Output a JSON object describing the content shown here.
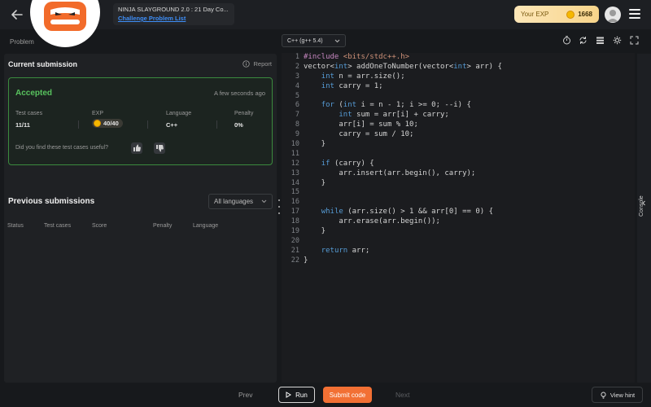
{
  "header": {
    "title": "NINJA SLAYGROUND 2.0 : 21 Day Co...",
    "link": "Challenge Problem List",
    "exp_label": "Your EXP",
    "exp_value": "1668"
  },
  "tabs": [
    {
      "label": "Problem"
    }
  ],
  "current_submission": {
    "title": "Current submission",
    "report_label": "Report",
    "status": "Accepted",
    "time": "A few seconds ago",
    "stats": {
      "test_cases_label": "Test cases",
      "test_cases_value": "11/11",
      "exp_label": "EXP",
      "exp_value": "40/40",
      "language_label": "Language",
      "language_value": "C++",
      "penalty_label": "Penalty",
      "penalty_value": "0%"
    },
    "feedback_question": "Did you find these test cases useful?"
  },
  "previous_submissions": {
    "title": "Previous submissions",
    "filter_value": "All languages",
    "columns": [
      "Status",
      "Test cases",
      "Score",
      "Penalty",
      "Language"
    ]
  },
  "editor": {
    "language": "C++ (g++ 5.4)",
    "line_numbers": [
      "1",
      "2",
      "3",
      "4",
      "5",
      "6",
      "7",
      "8",
      "9",
      "10",
      "11",
      "12",
      "13",
      "14",
      "15",
      "16",
      "17",
      "18",
      "19",
      "20",
      "21",
      "22"
    ]
  },
  "console_label": "Console",
  "footer": {
    "prev": "Prev",
    "run": "Run",
    "submit": "Submit code",
    "next": "Next",
    "hint": "View hint"
  },
  "colors": {
    "accent": "#f27034",
    "success": "#58c25e",
    "link": "#3e8ef7"
  }
}
